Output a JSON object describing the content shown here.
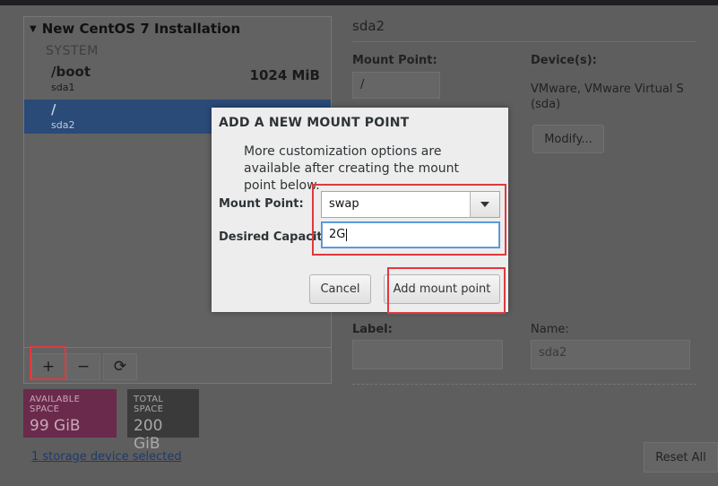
{
  "left_panel": {
    "header": "New CentOS 7 Installation",
    "system_label": "SYSTEM",
    "mount_points": [
      {
        "name": "/boot",
        "device": "sda1",
        "size": "1024 MiB"
      },
      {
        "name": "/",
        "device": "sda2",
        "size": ""
      }
    ],
    "toolbar": {
      "add": "+",
      "remove": "−",
      "refresh": "⟳"
    }
  },
  "space": {
    "available_label": "AVAILABLE SPACE",
    "available_value": "99 GiB",
    "total_label": "TOTAL SPACE",
    "total_value": "200 GiB"
  },
  "storage_link": "1 storage device selected",
  "right_panel": {
    "title": "sda2",
    "mount_point_label": "Mount Point:",
    "mount_point_value": "/",
    "devices_label": "Device(s):",
    "devices_value_line1": "VMware, VMware Virtual S",
    "devices_value_line2": "(sda)",
    "modify_button": "Modify...",
    "label_label": "Label:",
    "label_value": "",
    "name_label": "Name:",
    "name_value": "sda2",
    "reset_button": "Reset All"
  },
  "modal": {
    "title": "ADD A NEW MOUNT POINT",
    "description": "More customization options are available after creating the mount point below.",
    "mount_point_label": "Mount Point:",
    "mount_point_value": "swap",
    "capacity_label": "Desired Capacity:",
    "capacity_value": "2G",
    "cancel_button": "Cancel",
    "add_button": "Add mount point"
  },
  "colors": {
    "highlight": "#e0393e",
    "available_space": "#6a2a4c",
    "selected_row": "#2a4a78"
  }
}
